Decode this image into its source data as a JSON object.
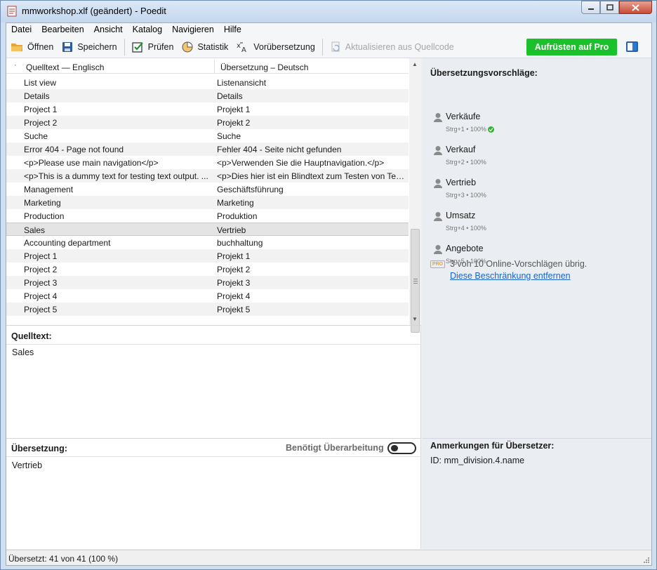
{
  "window": {
    "title": "mmworkshop.xlf (geändert) - Poedit"
  },
  "menu": [
    {
      "key": "datei",
      "label": "Datei"
    },
    {
      "key": "bearbeiten",
      "label": "Bearbeiten"
    },
    {
      "key": "ansicht",
      "label": "Ansicht"
    },
    {
      "key": "katalog",
      "label": "Katalog"
    },
    {
      "key": "navigieren",
      "label": "Navigieren"
    },
    {
      "key": "hilfe",
      "label": "Hilfe"
    }
  ],
  "toolbar": {
    "open_label": "Öffnen",
    "save_label": "Speichern",
    "validate_label": "Prüfen",
    "stats_label": "Statistik",
    "pretranslate_label": "Vorübersetzung",
    "update_label": "Aktualisieren aus Quellcode",
    "pro_label": "Aufrüsten auf Pro"
  },
  "list": {
    "header_dot": "·",
    "source_header": "Quelltext — Englisch",
    "translation_header": "Übersetzung – Deutsch",
    "rows": [
      {
        "source": "List view",
        "translation": "Listenansicht"
      },
      {
        "source": "Details",
        "translation": "Details"
      },
      {
        "source": "Project 1",
        "translation": "Projekt 1"
      },
      {
        "source": "Project 2",
        "translation": "Projekt 2"
      },
      {
        "source": "Suche",
        "translation": "Suche"
      },
      {
        "source": "Error 404 - Page not found",
        "translation": "Fehler 404 - Seite nicht gefunden"
      },
      {
        "source": "<p>Please use main navigation</p>",
        "translation": "<p>Verwenden Sie die Hauptnavigation.</p>"
      },
      {
        "source": "<p>This is a dummy text for testing text output. ...",
        "translation": "<p>Dies hier ist ein Blindtext zum Testen von Tex..."
      },
      {
        "source": "Management",
        "translation": "Geschäftsführung"
      },
      {
        "source": "Marketing",
        "translation": "Marketing"
      },
      {
        "source": "Production",
        "translation": "Produktion"
      },
      {
        "source": "Sales",
        "translation": "Vertrieb",
        "selected": true
      },
      {
        "source": "Accounting department",
        "translation": "buchhaltung"
      },
      {
        "source": "Project 1",
        "translation": "Projekt 1"
      },
      {
        "source": "Project 2",
        "translation": "Projekt 2"
      },
      {
        "source": "Project 3",
        "translation": "Projekt 3"
      },
      {
        "source": "Project 4",
        "translation": "Projekt 4"
      },
      {
        "source": "Project 5",
        "translation": "Projekt 5"
      }
    ]
  },
  "source_panel": {
    "label": "Quelltext:",
    "text": "Sales"
  },
  "translation_panel": {
    "label": "Übersetzung:",
    "needs_review_label": "Benötigt Überarbeitung",
    "needs_review_on": false,
    "text": "Vertrieb"
  },
  "suggestions": {
    "title": "Übersetzungsvorschläge:",
    "items": [
      {
        "text": "Verkäufe",
        "meta": "Strg+1 • 100%",
        "exact_match": true
      },
      {
        "text": "Verkauf",
        "meta": "Strg+2 • 100%"
      },
      {
        "text": "Vertrieb",
        "meta": "Strg+3 • 100%"
      },
      {
        "text": "Umsatz",
        "meta": "Strg+4 • 100%"
      },
      {
        "text": "Angebote",
        "meta": "Strg+5 • 100%"
      }
    ],
    "pro_badge": "PRO",
    "limit_text": "3 von 10 Online-Vorschlägen übrig.",
    "remove_limit_link": "Diese Beschränkung entfernen"
  },
  "notes": {
    "title": "Anmerkungen für Übersetzer:",
    "id_text": "ID: mm_division.4.name"
  },
  "status": {
    "text": "Übersetzt: 41 von 41 (100 %)"
  },
  "colors": {
    "pro_button": "#1ac12a",
    "link": "#1a64c8",
    "pro_badge": "#e6a23c",
    "match_check": "#2fb52f"
  }
}
